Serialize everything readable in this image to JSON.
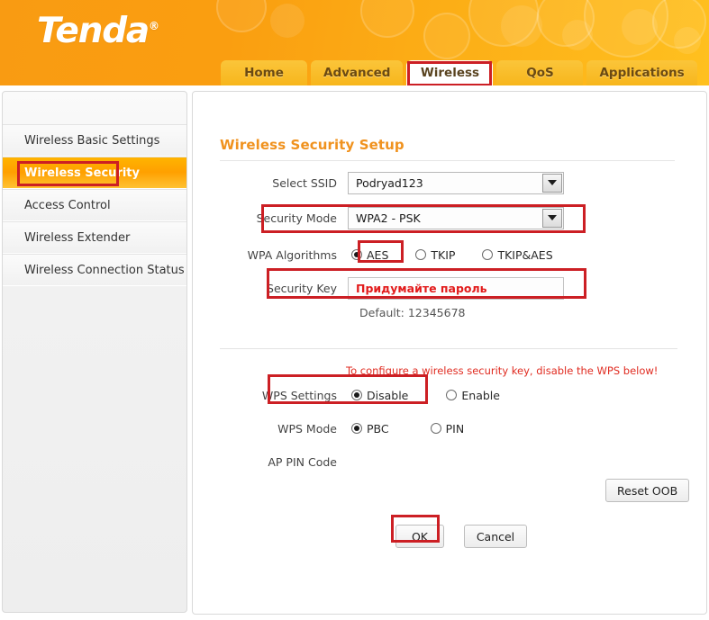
{
  "brand": {
    "logo_text": "Tenda",
    "logo_trademark": "®"
  },
  "nav": {
    "tabs": [
      {
        "label": "Home",
        "active": false
      },
      {
        "label": "Advanced",
        "active": false
      },
      {
        "label": "Wireless",
        "active": true
      },
      {
        "label": "QoS",
        "active": false
      },
      {
        "label": "Applications",
        "active": false
      }
    ]
  },
  "sidebar": {
    "items": [
      {
        "label": "Wireless Basic Settings",
        "active": false
      },
      {
        "label": "Wireless Security",
        "active": true
      },
      {
        "label": "Access Control",
        "active": false
      },
      {
        "label": "Wireless Extender",
        "active": false
      },
      {
        "label": "Wireless Connection Status",
        "active": false
      }
    ]
  },
  "main": {
    "section_title": "Wireless Security Setup",
    "fields": {
      "select_ssid": {
        "label": "Select SSID",
        "value": "Podryad123"
      },
      "security_mode": {
        "label": "Security Mode",
        "value": "WPA2 - PSK"
      },
      "wpa_algorithms": {
        "label": "WPA Algorithms",
        "options": [
          {
            "label": "AES",
            "checked": true
          },
          {
            "label": "TKIP",
            "checked": false
          },
          {
            "label": "TKIP&AES",
            "checked": false
          }
        ]
      },
      "security_key": {
        "label": "Security Key",
        "value": "Придумайте пароль",
        "default_hint": "Default: 12345678"
      },
      "wps_settings": {
        "label": "WPS Settings",
        "options": [
          {
            "label": "Disable",
            "checked": true
          },
          {
            "label": "Enable",
            "checked": false
          }
        ]
      },
      "wps_mode": {
        "label": "WPS Mode",
        "options": [
          {
            "label": "PBC",
            "checked": true
          },
          {
            "label": "PIN",
            "checked": false
          }
        ]
      },
      "ap_pin_code": {
        "label": "AP PIN Code",
        "value": ""
      }
    },
    "warning_text": "To configure a wireless security key, disable the WPS below!",
    "buttons": {
      "reset_oob": "Reset OOB",
      "ok": "OK",
      "cancel": "Cancel"
    }
  },
  "colors": {
    "brand_orange": "#f99b12",
    "tab_yellow": "#f7b61c",
    "annotation_red": "#cc1f24",
    "heading_orange": "#f0921e",
    "warning_red": "#e02b20",
    "key_red": "#e21b1b",
    "sidebar_active": "#ffa000"
  }
}
